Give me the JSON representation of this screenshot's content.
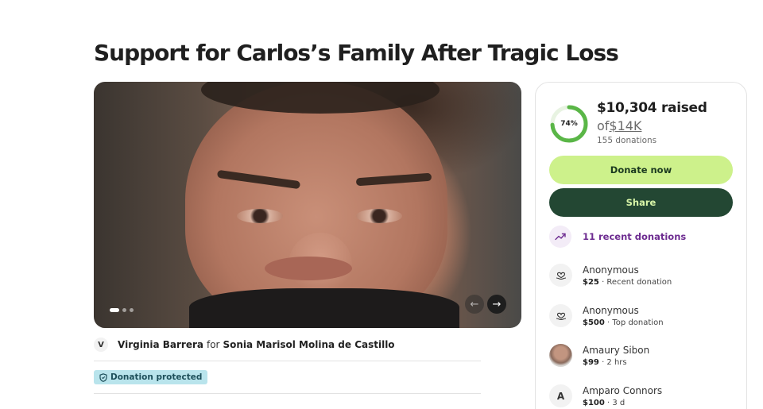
{
  "page": {
    "title": "Support for Carlos’s Family After Tragic Loss"
  },
  "organizer": {
    "initial": "V",
    "name": "Virginia Barrera",
    "for_label": "for",
    "beneficiary": "Sonia Marisol Molina de Castillo"
  },
  "badge": {
    "protected_label": "Donation protected"
  },
  "carousel": {
    "slide_count": 3,
    "active_slide": 1
  },
  "fundraiser": {
    "progress_percent": 74,
    "progress_label": "74%",
    "raised_text": "$10,304 raised",
    "goal_prefix": "of",
    "goal_amount": "$14K",
    "donations_count": "155 donations"
  },
  "actions": {
    "donate_label": "Donate now",
    "share_label": "Share"
  },
  "recent": {
    "label": "11 recent donations"
  },
  "donations": [
    {
      "name": "Anonymous",
      "amount": "$25",
      "detail": "· Recent donation",
      "avatar": "heart-hand-icon"
    },
    {
      "name": "Anonymous",
      "amount": "$500",
      "detail": "· Top donation",
      "avatar": "heart-hand-icon"
    },
    {
      "name": "Amaury Sibon",
      "amount": "$99",
      "detail": "· 2 hrs",
      "avatar": "photo"
    },
    {
      "name": "Amparo Connors",
      "amount": "$100",
      "detail": "· 3 d",
      "avatar": "A"
    }
  ],
  "colors": {
    "accent_green": "#cdf18b",
    "dark_green": "#234733",
    "progress_green": "#5ab647",
    "recent_purple": "#6e2d91",
    "protected_bg": "#b9e4ec"
  }
}
